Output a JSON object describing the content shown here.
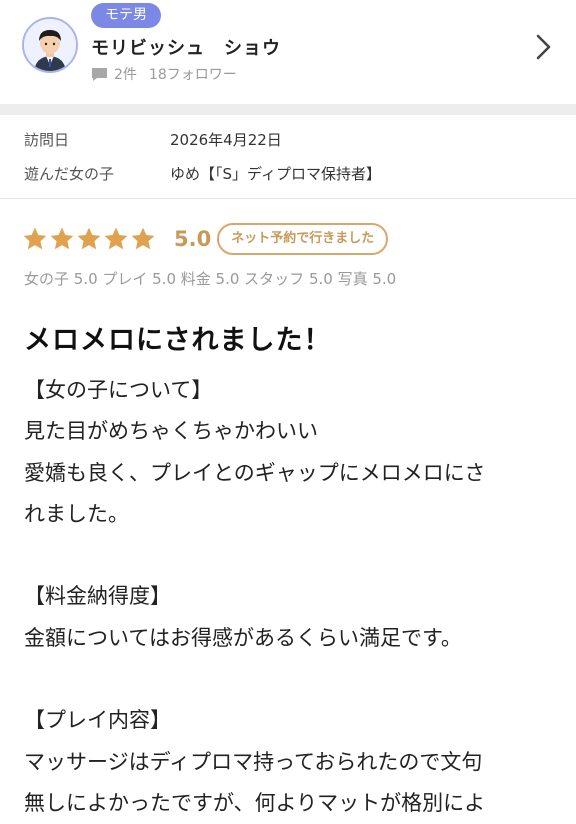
{
  "user": {
    "badge": "モテ男",
    "name": "モリビッシュ　ショウ",
    "post_count": "2件",
    "followers": "18フォロワー"
  },
  "info": {
    "visit_date_label": "訪問日",
    "visit_date": "2026年4月22日",
    "girl_label": "遊んだ女の子",
    "girl_value": "ゆめ【「S」ディプロマ保持者】"
  },
  "rating": {
    "stars": 5,
    "score": "5.0",
    "chip": "ネット予約で行きました",
    "sub": "女の子 5.0 プレイ 5.0 料金 5.0 スタッフ 5.0 写真 5.0"
  },
  "review": {
    "title": "メロメロにされました！",
    "lines": [
      "【女の子について】",
      "見た目がめちゃくちゃかわいい",
      "愛嬌も良く、プレイとのギャップにメロメロにさ",
      "れました。",
      "",
      "【料金納得度】",
      "金額についてはお得感があるくらい満足です。",
      "",
      "【プレイ内容】",
      "マッサージはディプロマ持っておられたので文句",
      "無しによかったですが、何よりマットが格別によ"
    ]
  },
  "colors": {
    "badge": "#7b88e6",
    "star": "#e0a24f",
    "score": "#c9995a"
  },
  "icons": [
    "avatar-icon",
    "comment-icon",
    "chevron-right-icon",
    "star-icon"
  ]
}
